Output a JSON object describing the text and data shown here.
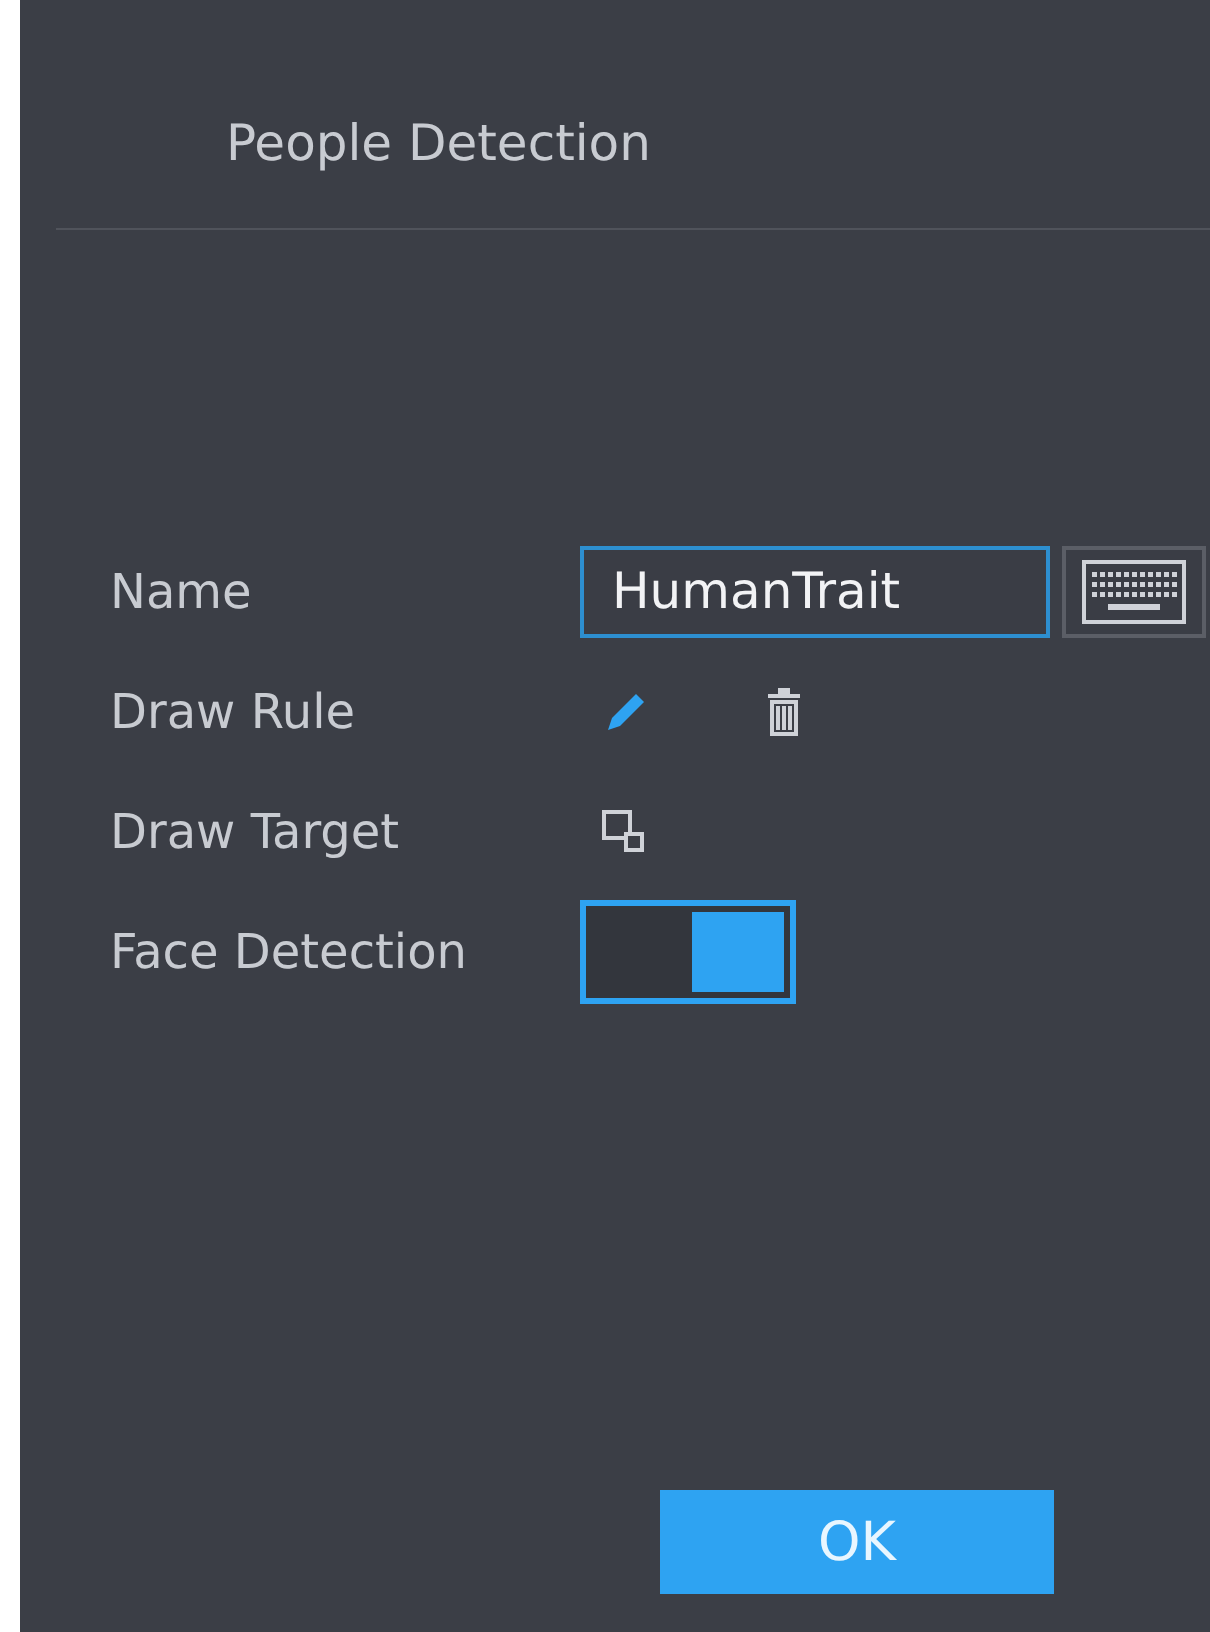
{
  "dialog": {
    "title": "People Detection"
  },
  "rows": [
    {
      "kind": "text",
      "label": "Name",
      "value": "HumanTrait"
    },
    {
      "kind": "draw_rule",
      "label": "Draw Rule"
    },
    {
      "kind": "draw_target",
      "label": "Draw Target"
    },
    {
      "kind": "toggle",
      "label": "Face Detection",
      "on": true
    }
  ],
  "buttons": [
    "OK"
  ]
}
